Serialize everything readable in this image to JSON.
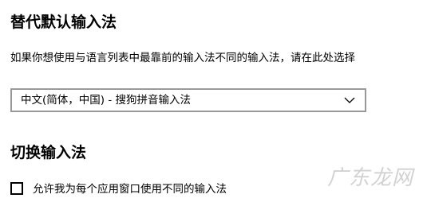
{
  "section_default_ime": {
    "title": "替代默认输入法",
    "description": "如果你想使用与语言列表中最靠前的输入法不同的输入法，请在此处选择",
    "dropdown": {
      "selected": "中文(简体，中国) - 搜狗拼音输入法",
      "icon": "chevron-down-icon"
    }
  },
  "section_switch_ime": {
    "title": "切换输入法",
    "checkbox": {
      "label": "允许我为每个应用窗口使用不同的输入法",
      "checked": false
    }
  },
  "watermark": {
    "text": "广东龙网"
  }
}
